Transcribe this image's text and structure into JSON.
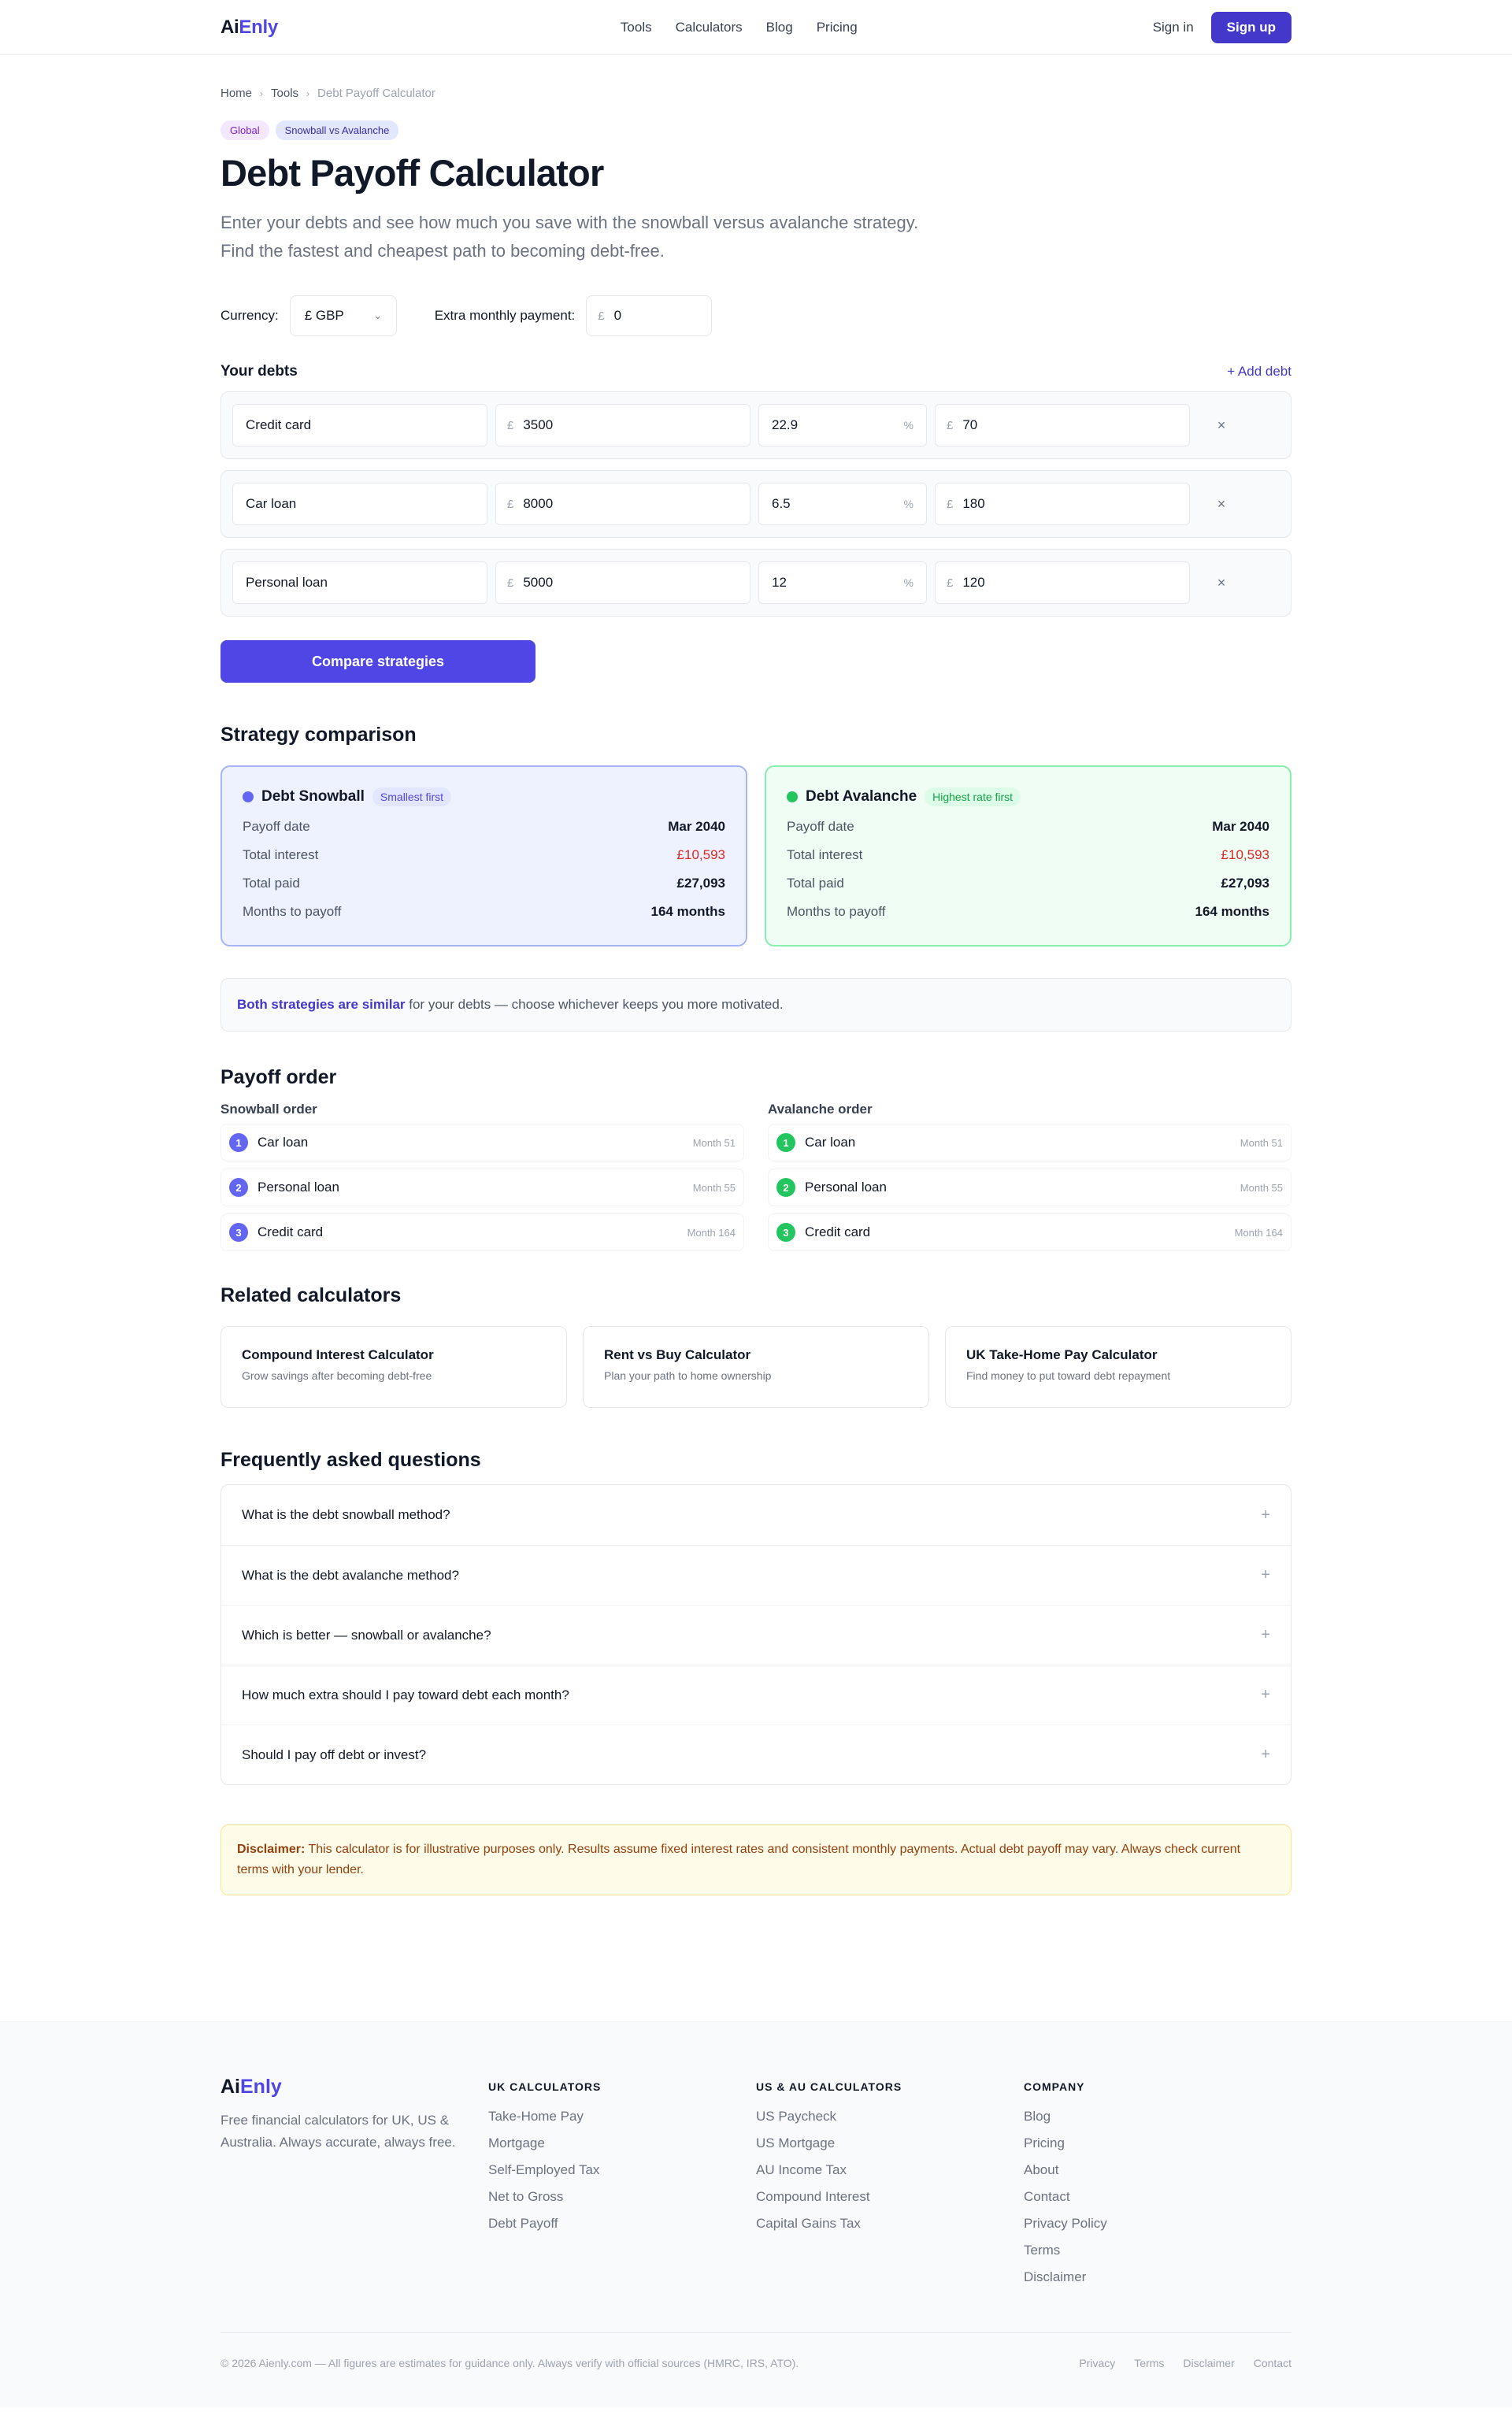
{
  "nav": {
    "logo_a": "Ai",
    "logo_b": "Enly",
    "links": [
      "Tools",
      "Calculators",
      "Blog",
      "Pricing"
    ],
    "signin": "Sign in",
    "signup": "Sign up"
  },
  "breadcrumb": [
    "Home",
    "Tools",
    "Debt Payoff Calculator"
  ],
  "badges": [
    "Global",
    "Snowball vs Avalanche"
  ],
  "title": "Debt Payoff Calculator",
  "lead": "Enter your debts and see how much you save with the snowball versus avalanche strategy. Find the fastest and cheapest path to becoming debt-free.",
  "controls": {
    "currency_label": "Currency:",
    "currency_value": "£ GBP",
    "extra_label": "Extra monthly payment:",
    "currency_symbol": "£",
    "extra_value": "0"
  },
  "debts": {
    "heading": "Your debts",
    "add_label": "+ Add debt",
    "pct_symbol": "%",
    "remove_glyph": "×",
    "rows": [
      {
        "name": "Credit card",
        "balance": "3500",
        "rate": "22.9",
        "payment": "70"
      },
      {
        "name": "Car loan",
        "balance": "8000",
        "rate": "6.5",
        "payment": "180"
      },
      {
        "name": "Personal loan",
        "balance": "5000",
        "rate": "12",
        "payment": "120"
      }
    ]
  },
  "compare_button": "Compare strategies",
  "strategy": {
    "heading": "Strategy comparison",
    "snowball": {
      "name": "Debt Snowball",
      "pill": "Smallest first",
      "stats": [
        {
          "k": "Payoff date",
          "v": "Mar 2040"
        },
        {
          "k": "Total interest",
          "v": "£10,593"
        },
        {
          "k": "Total paid",
          "v": "£27,093"
        },
        {
          "k": "Months to payoff",
          "v": "164 months"
        }
      ]
    },
    "avalanche": {
      "name": "Debt Avalanche",
      "pill": "Highest rate first",
      "stats": [
        {
          "k": "Payoff date",
          "v": "Mar 2040"
        },
        {
          "k": "Total interest",
          "v": "£10,593"
        },
        {
          "k": "Total paid",
          "v": "£27,093"
        },
        {
          "k": "Months to payoff",
          "v": "164 months"
        }
      ]
    },
    "note_bold": "Both strategies are similar",
    "note_rest": " for your debts — choose whichever keeps you more motivated."
  },
  "payoff_order": {
    "heading": "Payoff order",
    "snowball_heading": "Snowball order",
    "avalanche_heading": "Avalanche order",
    "snowball": [
      {
        "n": "1",
        "name": "Car loan",
        "month": "Month 51"
      },
      {
        "n": "2",
        "name": "Personal loan",
        "month": "Month 55"
      },
      {
        "n": "3",
        "name": "Credit card",
        "month": "Month 164"
      }
    ],
    "avalanche": [
      {
        "n": "1",
        "name": "Car loan",
        "month": "Month 51"
      },
      {
        "n": "2",
        "name": "Personal loan",
        "month": "Month 55"
      },
      {
        "n": "3",
        "name": "Credit card",
        "month": "Month 164"
      }
    ]
  },
  "related": {
    "heading": "Related calculators",
    "items": [
      {
        "title": "Compound Interest Calculator",
        "desc": "Grow savings after becoming debt-free"
      },
      {
        "title": "Rent vs Buy Calculator",
        "desc": "Plan your path to home ownership"
      },
      {
        "title": "UK Take-Home Pay Calculator",
        "desc": "Find money to put toward debt repayment"
      }
    ]
  },
  "faq": {
    "heading": "Frequently asked questions",
    "plus": "+",
    "items": [
      "What is the debt snowball method?",
      "What is the debt avalanche method?",
      "Which is better — snowball or avalanche?",
      "How much extra should I pay toward debt each month?",
      "Should I pay off debt or invest?"
    ]
  },
  "disclaimer": {
    "bold": "Disclaimer:",
    "text": " This calculator is for illustrative purposes only. Results assume fixed interest rates and consistent monthly payments. Actual debt payoff may vary. Always check current terms with your lender."
  },
  "footer": {
    "logo_a": "Ai",
    "logo_b": "Enly",
    "tagline": "Free financial calculators for UK, US & Australia. Always accurate, always free.",
    "cols": [
      {
        "title": "UK CALCULATORS",
        "links": [
          "Take-Home Pay",
          "Mortgage",
          "Self-Employed Tax",
          "Net to Gross",
          "Debt Payoff"
        ]
      },
      {
        "title": "US & AU CALCULATORS",
        "links": [
          "US Paycheck",
          "US Mortgage",
          "AU Income Tax",
          "Compound Interest",
          "Capital Gains Tax"
        ]
      },
      {
        "title": "COMPANY",
        "links": [
          "Blog",
          "Pricing",
          "About",
          "Contact",
          "Privacy Policy",
          "Terms",
          "Disclaimer"
        ]
      }
    ],
    "copyright": "© 2026 Aienly.com — All figures are estimates for guidance only. Always verify with official sources (HMRC, IRS, ATO).",
    "bottom_links": [
      "Privacy",
      "Terms",
      "Disclaimer",
      "Contact"
    ]
  },
  "colors": {
    "brand": "#4f46e5",
    "snowball": "#6366f1",
    "avalanche": "#22c55e",
    "interest": "#dc2626"
  }
}
